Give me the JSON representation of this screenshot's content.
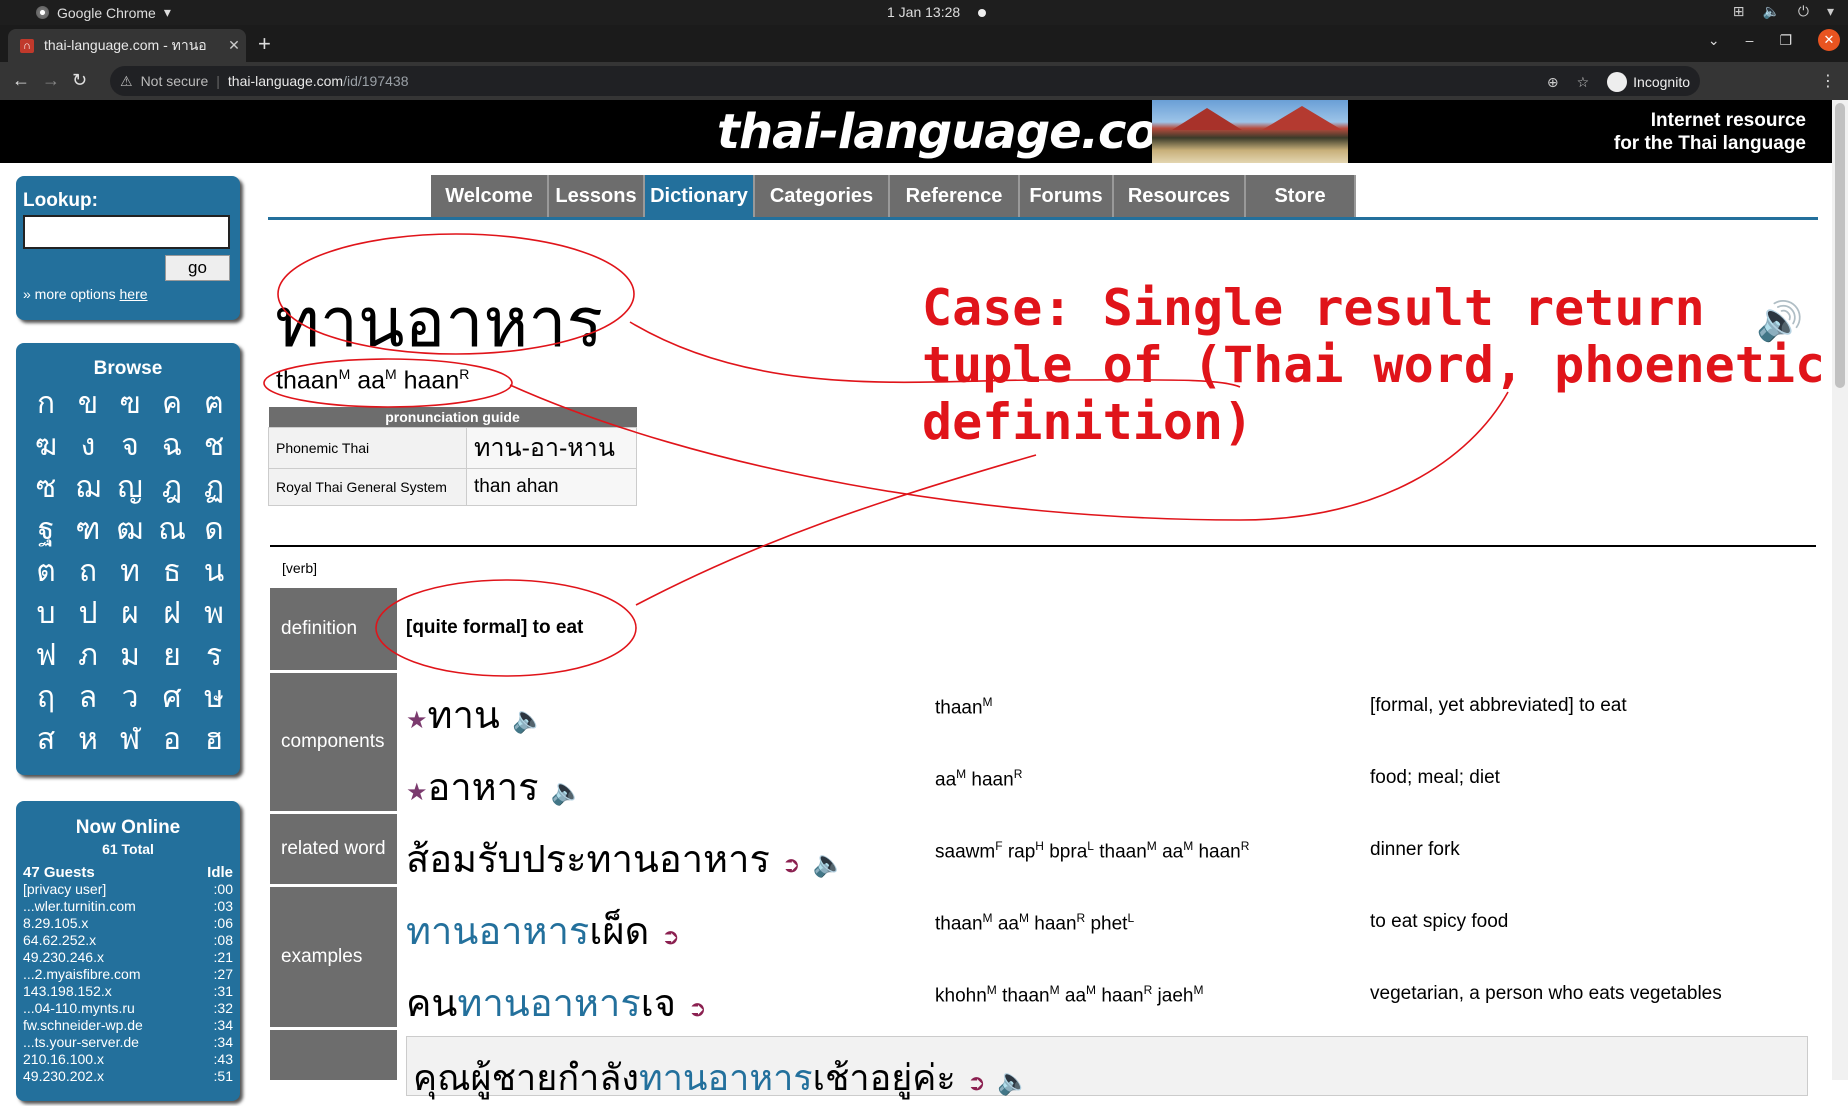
{
  "os": {
    "app_name": "Google Chrome",
    "clock": "1 Jan  13:28"
  },
  "browser": {
    "tab_title": "thai-language.com - ทานอ",
    "security": "Not secure",
    "url_host": "thai-language.com",
    "url_path": "/id/197438",
    "profile": "Incognito"
  },
  "site": {
    "logo": "thai-language.com",
    "tagline_line1": "Internet resource",
    "tagline_line2": "for the Thai language",
    "nav": [
      {
        "label": "Welcome",
        "active": false
      },
      {
        "label": "Lessons",
        "active": false
      },
      {
        "label": "Dictionary",
        "active": true
      },
      {
        "label": "Categories",
        "active": false
      },
      {
        "label": "Reference",
        "active": false
      },
      {
        "label": "Forums",
        "active": false
      },
      {
        "label": "Resources",
        "active": false
      },
      {
        "label": "Store",
        "active": false
      }
    ]
  },
  "sidebar": {
    "lookup_label": "Lookup:",
    "lookup_value": "",
    "go_label": "go",
    "more_options_prefix": "» more options ",
    "more_options_link": "here",
    "browse_title": "Browse",
    "browse_letters": [
      "ก",
      "ข",
      "ฃ",
      "ค",
      "ฅ",
      "ฆ",
      "ง",
      "จ",
      "ฉ",
      "ช",
      "ซ",
      "ฌ",
      "ญ",
      "ฎ",
      "ฏ",
      "ฐ",
      "ฑ",
      "ฒ",
      "ณ",
      "ด",
      "ต",
      "ถ",
      "ท",
      "ธ",
      "น",
      "บ",
      "ป",
      "ผ",
      "ฝ",
      "พ",
      "ฟ",
      "ภ",
      "ม",
      "ย",
      "ร",
      "ฤ",
      "ล",
      "ว",
      "ศ",
      "ษ",
      "ส",
      "ห",
      "ฬ",
      "อ",
      "ฮ"
    ],
    "online_title": "Now Online",
    "online_total": "61 Total",
    "online_guests": "47 Guests",
    "online_idle_header": "Idle",
    "online_users": [
      {
        "name": "[privacy user]",
        "idle": ":00"
      },
      {
        "name": "...wler.turnitin.com",
        "idle": ":03"
      },
      {
        "name": "8.29.105.x",
        "idle": ":06"
      },
      {
        "name": "64.62.252.x",
        "idle": ":08"
      },
      {
        "name": "49.230.246.x",
        "idle": ":21"
      },
      {
        "name": "...2.myaisfibre.com",
        "idle": ":27"
      },
      {
        "name": "143.198.152.x",
        "idle": ":31"
      },
      {
        "name": "...04-110.mynts.ru",
        "idle": ":32"
      },
      {
        "name": "fw.schneider-wp.de",
        "idle": ":34"
      },
      {
        "name": "...ts.your-server.de",
        "idle": ":34"
      },
      {
        "name": "210.16.100.x",
        "idle": ":43"
      },
      {
        "name": "49.230.202.x",
        "idle": ":51"
      }
    ]
  },
  "entry": {
    "headword": "ทานอาหาร",
    "phonetic": [
      {
        "syl": "thaan",
        "tone": "M"
      },
      {
        "syl": "aa",
        "tone": "M"
      },
      {
        "syl": "haan",
        "tone": "R"
      }
    ],
    "pron_guide_title": "pronunciation guide",
    "pron_rows": [
      {
        "system": "Phonemic Thai",
        "value": "ทาน-อา-หาน"
      },
      {
        "system": "Royal Thai General System",
        "value": "than ahan"
      }
    ],
    "pos": "[verb]",
    "definition_label": "definition",
    "definition": "[quite formal] to eat",
    "components_label": "components",
    "components": [
      {
        "thai": "ทาน",
        "phonetic": [
          {
            "syl": "thaan",
            "tone": "M"
          }
        ],
        "meaning": "[formal, yet abbreviated] to eat"
      },
      {
        "thai": "อาหาร",
        "phonetic": [
          {
            "syl": "aa",
            "tone": "M"
          },
          {
            "syl": "haan",
            "tone": "R"
          }
        ],
        "meaning": "food; meal; diet"
      }
    ],
    "related_label": "related word",
    "related": {
      "thai": "ส้อมรับประทานอาหาร",
      "phonetic": [
        {
          "syl": "saawm",
          "tone": "F"
        },
        {
          "syl": "rap",
          "tone": "H"
        },
        {
          "syl": "bpra",
          "tone": "L"
        },
        {
          "syl": "thaan",
          "tone": "M"
        },
        {
          "syl": "aa",
          "tone": "M"
        },
        {
          "syl": "haan",
          "tone": "R"
        }
      ],
      "meaning": "dinner fork"
    },
    "examples_label": "examples",
    "examples": [
      {
        "thai_hl": "ทานอาหาร",
        "thai_rest": "เผ็ด",
        "thai_pre": "",
        "phonetic": [
          {
            "syl": "thaan",
            "tone": "M"
          },
          {
            "syl": "aa",
            "tone": "M"
          },
          {
            "syl": "haan",
            "tone": "R"
          },
          {
            "syl": "phet",
            "tone": "L"
          }
        ],
        "meaning": "to eat spicy food"
      },
      {
        "thai_pre": "คน",
        "thai_hl": "ทานอาหาร",
        "thai_rest": "เจ",
        "phonetic": [
          {
            "syl": "khohn",
            "tone": "M"
          },
          {
            "syl": "thaan",
            "tone": "M"
          },
          {
            "syl": "aa",
            "tone": "M"
          },
          {
            "syl": "haan",
            "tone": "R"
          },
          {
            "syl": "jaeh",
            "tone": "M"
          }
        ],
        "meaning": "vegetarian, a person who eats vegetables"
      }
    ],
    "example_sentence": {
      "pre": "คุณผู้ชายกำลัง",
      "hl": "ทานอาหาร",
      "rest": "เช้าอยู่ค่ะ"
    }
  },
  "annotation": {
    "text": "Case: Single result return\ntuple of (Thai word, phoenetic,\ndefinition)",
    "color": "#e0141a"
  }
}
